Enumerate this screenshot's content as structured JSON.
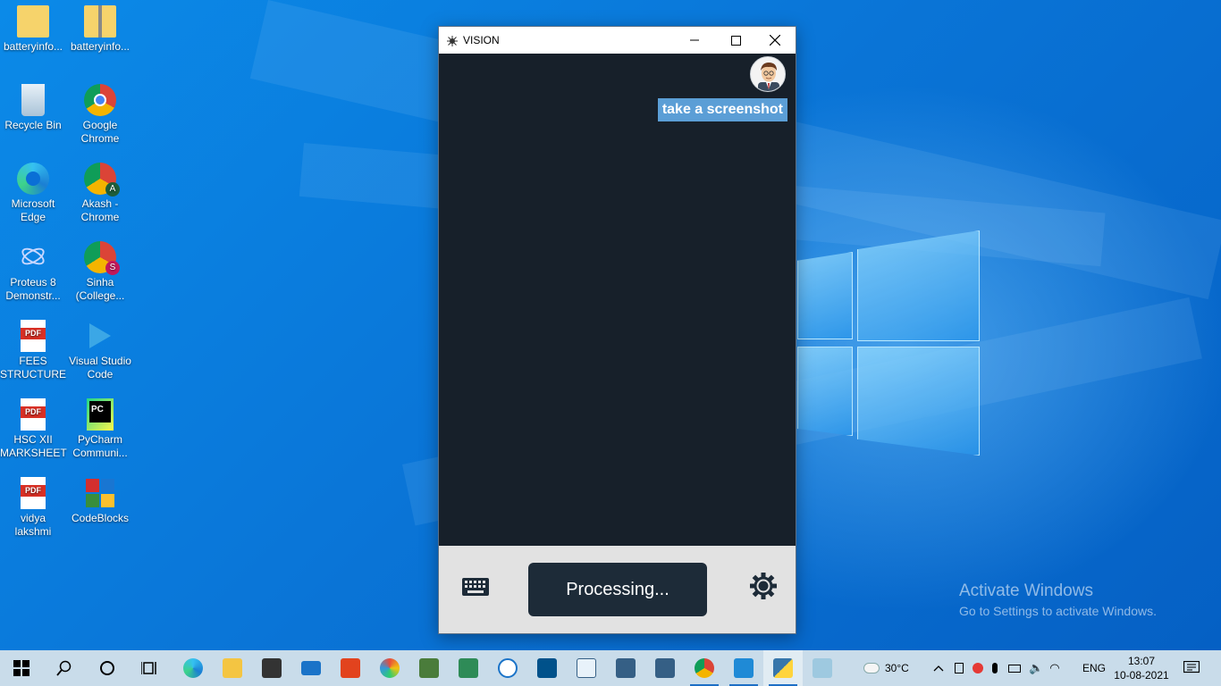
{
  "desktop": {
    "icons": [
      {
        "label": "batteryinfo...",
        "icon": "folder-icon"
      },
      {
        "label": "batteryinfo...",
        "icon": "zip-folder-icon"
      },
      {
        "label": "Recycle Bin",
        "icon": "recycle-bin-icon"
      },
      {
        "label": "Google\nChrome",
        "icon": "chrome-icon"
      },
      {
        "label": "Microsoft\nEdge",
        "icon": "edge-icon"
      },
      {
        "label": "Akash -\nChrome",
        "icon": "chrome-profile-icon"
      },
      {
        "label": "Proteus 8\nDemonstr...",
        "icon": "proteus-icon"
      },
      {
        "label": "Sinha\n(College...",
        "icon": "chrome-profile-icon"
      },
      {
        "label": "FEES\nSTRUCTURE",
        "icon": "pdf-icon"
      },
      {
        "label": "Visual Studio\nCode",
        "icon": "vscode-icon"
      },
      {
        "label": "HSC XII\nMARKSHEET",
        "icon": "pdf-icon"
      },
      {
        "label": "PyCharm\nCommuni...",
        "icon": "pycharm-icon"
      },
      {
        "label": "vidya\nlakshmi",
        "icon": "pdf-icon"
      },
      {
        "label": "CodeBlocks",
        "icon": "codeblocks-icon"
      }
    ],
    "pdf_badge": "PDF",
    "pycharm_badge": "PC",
    "akash_badge": "A",
    "sinha_badge": "S"
  },
  "window": {
    "title": "VISION",
    "chat": {
      "message": "take a screenshot"
    },
    "status_button": "Processing...",
    "colors": {
      "background": "#17202a",
      "bubble": "#5b9ed6",
      "panel": "#e2e2e2",
      "button": "#1d2b38"
    }
  },
  "watermark": {
    "line1": "Activate Windows",
    "line2": "Go to Settings to activate Windows."
  },
  "taskbar": {
    "apps": [
      "start-icon",
      "search-icon",
      "cortana-icon",
      "task-view-icon",
      "edge-icon",
      "file-explorer-icon",
      "store-icon",
      "mail-icon",
      "office-icon",
      "paint-icon",
      "excel-icon",
      "network-app-icon",
      "app-icon",
      "arduino-icon",
      "mysql-icon",
      "mysql-icon",
      "mysql-icon",
      "chrome-icon",
      "vscode-icon",
      "python-icon",
      "app-icon"
    ],
    "weather": "30°C",
    "language": "ENG",
    "time": "13:07",
    "date": "10-08-2021"
  }
}
